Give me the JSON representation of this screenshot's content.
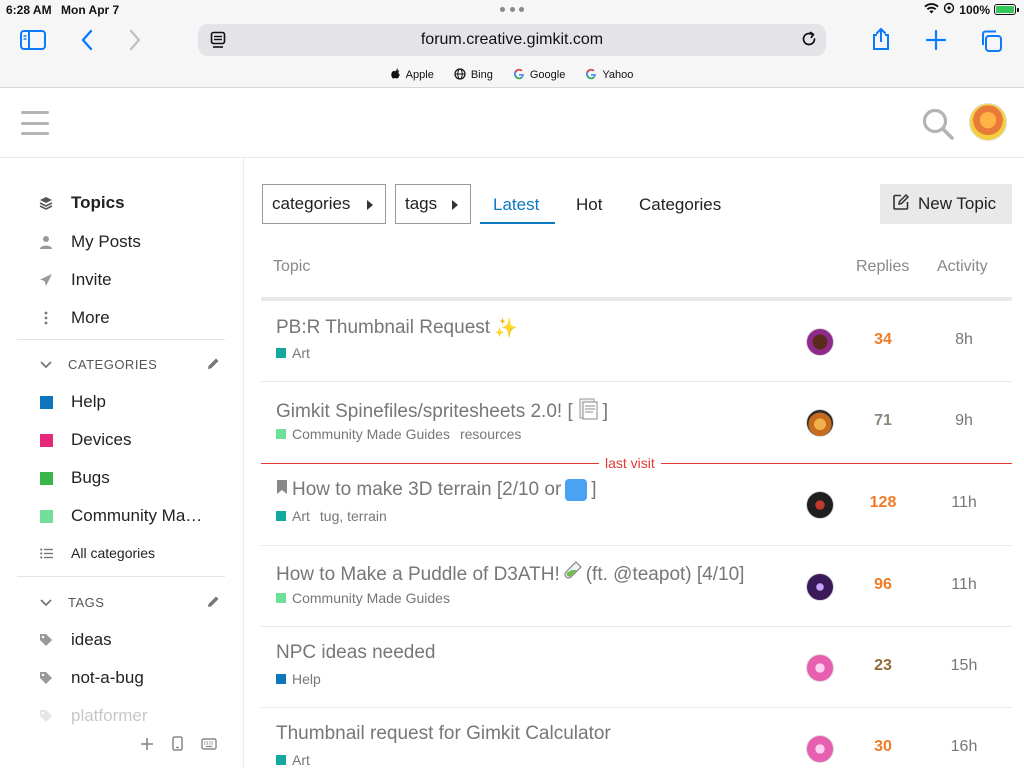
{
  "status_bar": {
    "time": "6:28 AM",
    "date": "Mon Apr 7",
    "battery": "100%",
    "battery_level": 1.0
  },
  "browser": {
    "url": "forum.creative.gimkit.com",
    "favorites": [
      {
        "label": "Apple",
        "icon": "apple-icon"
      },
      {
        "label": "Bing",
        "icon": "globe-icon"
      },
      {
        "label": "Google",
        "icon": "google-icon"
      },
      {
        "label": "Yahoo",
        "icon": "google-icon"
      }
    ]
  },
  "sidebar": {
    "nav": [
      {
        "label": "Topics",
        "icon": "layers-icon"
      },
      {
        "label": "My Posts",
        "icon": "user-icon"
      },
      {
        "label": "Invite",
        "icon": "paper-plane-icon"
      },
      {
        "label": "More",
        "icon": "vertical-dots-icon"
      }
    ],
    "categories_heading": "CATEGORIES",
    "categories": [
      {
        "label": "Help",
        "color": "#0e76bd"
      },
      {
        "label": "Devices",
        "color": "#e6287a"
      },
      {
        "label": "Bugs",
        "color": "#3ab54a"
      },
      {
        "label": "Community Ma…",
        "color": "#6fdf9a"
      }
    ],
    "all_categories": "All categories",
    "tags_heading": "TAGS",
    "tags": [
      {
        "label": "ideas"
      },
      {
        "label": "not-a-bug"
      },
      {
        "label": "platformer"
      }
    ]
  },
  "main": {
    "filters": {
      "categories": "categories",
      "tags": "tags"
    },
    "tabs": [
      {
        "label": "Latest",
        "active": true
      },
      {
        "label": "Hot",
        "active": false
      },
      {
        "label": "Categories",
        "active": false
      }
    ],
    "new_topic": "New Topic",
    "columns": {
      "topic": "Topic",
      "replies": "Replies",
      "activity": "Activity"
    },
    "last_visit": "last visit",
    "topics": [
      {
        "title": "PB:R Thumbnail Request",
        "title_suffix": "✨",
        "category": "Art",
        "category_color": "#12a89d",
        "tags": "",
        "replies": "34",
        "replies_color": "#f07a27",
        "activity": "8h",
        "avatar_color": "#8e2a8a"
      },
      {
        "title": "Gimkit Spinefiles/spritesheets 2.0! [",
        "title_suffix": "]",
        "category": "Community Made Guides",
        "category_color": "#6fdf9a",
        "tags": "resources",
        "replies": "71",
        "replies_color": "#8a8a7a",
        "activity": "9h",
        "avatar_color": "#c76b1e"
      },
      {
        "title": "How to make 3D terrain [2/10 or",
        "title_suffix": "]",
        "category": "Art",
        "category_color": "#12a89d",
        "tags": "tug, terrain",
        "replies": "128",
        "replies_color": "#f07a27",
        "activity": "11h",
        "avatar_color": "#1f1f1f",
        "bookmarked": true
      },
      {
        "title": "How to Make a Puddle of D3ATH!",
        "title_suffix": "(ft. @teapot) [4/10]",
        "category": "Community Made Guides",
        "category_color": "#6fdf9a",
        "tags": "",
        "replies": "96",
        "replies_color": "#f07a27",
        "activity": "11h",
        "avatar_color": "#3b1a5a"
      },
      {
        "title": "NPC ideas needed",
        "title_suffix": "",
        "category": "Help",
        "category_color": "#0e76bd",
        "tags": "",
        "replies": "23",
        "replies_color": "#8f6c3a",
        "activity": "15h",
        "avatar_color": "#e65fb0"
      },
      {
        "title": "Thumbnail request for Gimkit Calculator",
        "title_suffix": "",
        "category": "Art",
        "category_color": "#12a89d",
        "tags": "",
        "replies": "30",
        "replies_color": "#f07a27",
        "activity": "16h",
        "avatar_color": "#e65fb0"
      }
    ]
  }
}
